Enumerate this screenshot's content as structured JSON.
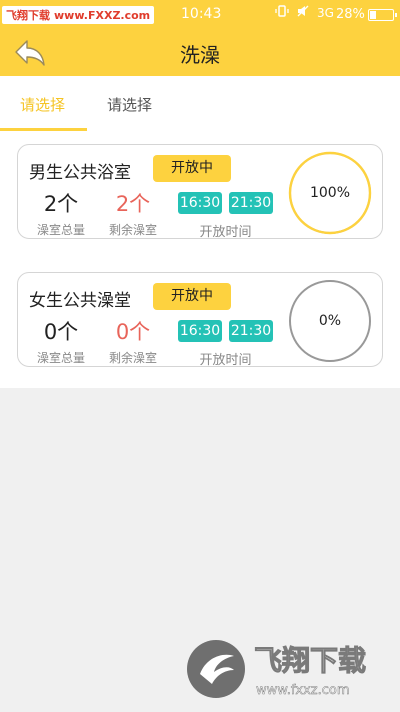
{
  "status_bar": {
    "watermark_site": "飞翔下载",
    "watermark_url": "www.FXXZ.com",
    "time": "10:43",
    "network": "3G",
    "battery": "28%",
    "battery_level": 0.28
  },
  "header": {
    "title": "洗澡",
    "back_icon": "back-arrow-icon"
  },
  "tabs": [
    {
      "label": "请选择",
      "active": true
    },
    {
      "label": "请选择",
      "active": false
    }
  ],
  "colors": {
    "accent": "#fdd23f",
    "teal": "#24c2b6",
    "red": "#e8645a",
    "ring_gray": "#999999"
  },
  "facilities": [
    {
      "name": "男生公共浴室",
      "status": "开放中",
      "total": "2个",
      "total_label": "澡室总量",
      "remaining": "2个",
      "remaining_label": "剩余澡室",
      "open_time": "16:30",
      "close_time": "21:30",
      "time_label": "开放时间",
      "usage_percent": "100%",
      "usage_fraction": 1.0
    },
    {
      "name": "女生公共澡堂",
      "status": "开放中",
      "total": "0个",
      "total_label": "澡室总量",
      "remaining": "0个",
      "remaining_label": "剩余澡室",
      "open_time": "16:30",
      "close_time": "21:30",
      "time_label": "开放时间",
      "usage_percent": "0%",
      "usage_fraction": 0.0
    }
  ],
  "watermark_logo": {
    "text": "飞翔下载",
    "url": "www.fxxz.com"
  }
}
